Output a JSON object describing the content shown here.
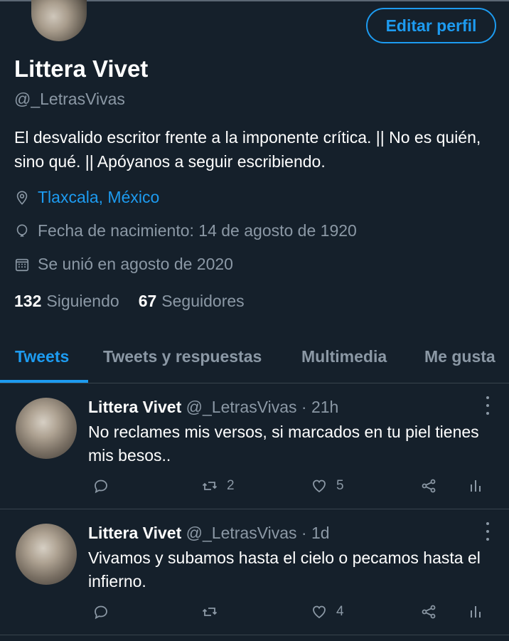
{
  "profile": {
    "edit_button": "Editar perfil",
    "display_name": "Littera Vivet",
    "handle": "@_LetrasVivas",
    "bio": "El desvalido escritor frente a la imponente crítica. || No es quién, sino qué. || Apóyanos a seguir escribiendo.",
    "location": "Tlaxcala, México",
    "birthdate": "Fecha de nacimiento: 14 de agosto de 1920",
    "joined": "Se unió en agosto de 2020",
    "following_count": "132",
    "following_label": "Siguiendo",
    "followers_count": "67",
    "followers_label": "Seguidores"
  },
  "tabs": [
    "Tweets",
    "Tweets y respuestas",
    "Multimedia",
    "Me gusta"
  ],
  "active_tab": "Tweets",
  "tweets": [
    {
      "name": "Littera Vivet",
      "handle": "@_LetrasVivas · 21h",
      "text": "No reclames mis versos, si marcados en tu piel tienes mis besos..",
      "retweets": "2",
      "likes": "5"
    },
    {
      "name": "Littera Vivet",
      "handle": "@_LetrasVivas · 1d",
      "text": "Vivamos y subamos hasta el cielo o pecamos hasta el infierno.",
      "retweets": "",
      "likes": "4"
    }
  ],
  "colors": {
    "background": "#15202b",
    "accent": "#1d9bf0",
    "muted": "#8b98a5",
    "divider": "#38444d"
  }
}
